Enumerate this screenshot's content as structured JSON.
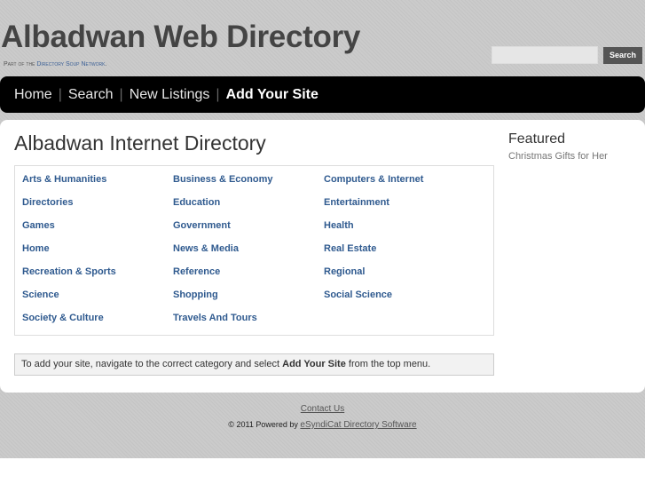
{
  "header": {
    "title": "Albadwan Web Directory",
    "tagline_prefix": "Part of the ",
    "tagline_link": "Directory Soup Network",
    "tagline_suffix": ".",
    "search_placeholder": "",
    "search_button": "Search"
  },
  "nav": [
    "Home",
    "Search",
    "New Listings",
    "Add Your Site"
  ],
  "main": {
    "heading": "Albadwan Internet Directory",
    "categories": [
      [
        "Arts & Humanities",
        "Business & Economy",
        "Computers & Internet"
      ],
      [
        "Directories",
        "Education",
        "Entertainment"
      ],
      [
        "Games",
        "Government",
        "Health"
      ],
      [
        "Home",
        "News & Media",
        "Real Estate"
      ],
      [
        "Recreation & Sports",
        "Reference",
        "Regional"
      ],
      [
        "Science",
        "Shopping",
        "Social Science"
      ],
      [
        "Society & Culture",
        "Travels And Tours",
        ""
      ]
    ],
    "notice_prefix": "To add your site, navigate to the correct category and select ",
    "notice_bold": "Add Your Site",
    "notice_suffix": " from the top menu."
  },
  "sidebar": {
    "heading": "Featured",
    "link": "Christmas Gifts for Her"
  },
  "footer": {
    "contact": "Contact Us",
    "powered_prefix": "© 2011 Powered by ",
    "powered_link": "eSyndiCat Directory Software"
  }
}
